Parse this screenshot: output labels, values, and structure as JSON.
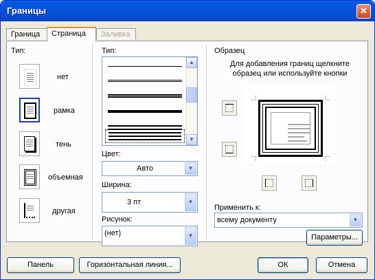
{
  "window": {
    "title": "Границы"
  },
  "tabs": [
    {
      "label": "Граница",
      "state": "normal"
    },
    {
      "label": "Страница",
      "state": "active"
    },
    {
      "label": "Заливка",
      "state": "disabled"
    }
  ],
  "type_section": {
    "label": "Тип:",
    "options": [
      {
        "label": "нет",
        "selected": false,
        "icon": "none-border-icon"
      },
      {
        "label": "рамка",
        "selected": true,
        "icon": "box-border-icon"
      },
      {
        "label": "тень",
        "selected": false,
        "icon": "shadow-border-icon"
      },
      {
        "label": "объемная",
        "selected": false,
        "icon": "3d-border-icon"
      },
      {
        "label": "другая",
        "selected": false,
        "icon": "custom-border-icon"
      }
    ]
  },
  "style_section": {
    "label": "Тип:",
    "color_label": "Цвет:",
    "color_value": "Авто",
    "width_label": "Ширина:",
    "width_value": "3 пт",
    "art_label": "Рисунок:",
    "art_value": "(нет)"
  },
  "preview_section": {
    "label": "Образец",
    "hint": "Для добавления границ щелкните образец или используйте кнопки",
    "apply_label": "Применить к:",
    "apply_value": "всему документу",
    "options_button": "Параметры..."
  },
  "footer": {
    "toolbar_button": "Панель",
    "hline_button": "Горизонтальная линия...",
    "ok_button": "ОК",
    "cancel_button": "Отмена"
  }
}
